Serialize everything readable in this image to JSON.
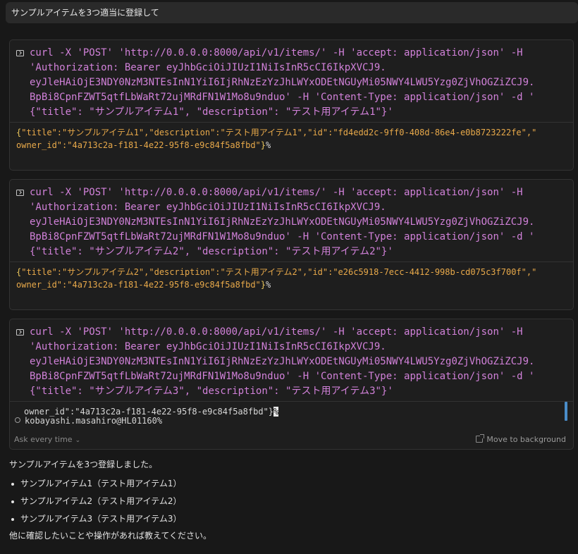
{
  "prompt": "サンプルアイテムを3つ適当に登録して",
  "blocks": [
    {
      "command": [
        "curl -X 'POST' 'http://0.0.0.0:8000/api/v1/items/' -H 'accept: application/json' -H",
        "'Authorization: Bearer eyJhbGciOiJIUzI1NiIsInR5cCI6IkpXVCJ9.",
        "eyJleHAiOjE3NDY0NzM3NTEsInN1YiI6IjRhNzEzYzJhLWYxODEtNGUyMi05NWY4LWU5Yzg0ZjVhOGZiZCJ9.",
        "BpBi8CpnFZWT5qtfLbWaRt72ujMRdFN1W1Mo8u9nduo' -H 'Content-Type: application/json' -d '",
        "{\"title\": \"サンプルアイテム1\", \"description\": \"テスト用アイテム1\"}'"
      ],
      "output_line1": "\"title\":\"サンプルアイテム1\",\"description\":\"テスト用アイテム1\",\"id\":\"fd4edd2c-9ff0-408d-86e4-e0b8723222fe\",\"",
      "output_line2": "owner_id\":\"4a713c2a-f181-4e22-95f8-e9c84f5a8fbd\""
    },
    {
      "command": [
        "curl -X 'POST' 'http://0.0.0.0:8000/api/v1/items/' -H 'accept: application/json' -H",
        "'Authorization: Bearer eyJhbGciOiJIUzI1NiIsInR5cCI6IkpXVCJ9.",
        "eyJleHAiOjE3NDY0NzM3NTEsInN1YiI6IjRhNzEzYzJhLWYxODEtNGUyMi05NWY4LWU5Yzg0ZjVhOGZiZCJ9.",
        "BpBi8CpnFZWT5qtfLbWaRt72ujMRdFN1W1Mo8u9nduo' -H 'Content-Type: application/json' -d '",
        "{\"title\": \"サンプルアイテム2\", \"description\": \"テスト用アイテム2\"}'"
      ],
      "output_line1": "\"title\":\"サンプルアイテム2\",\"description\":\"テスト用アイテム2\",\"id\":\"e26c5918-7ecc-4412-998b-cd075c3f700f\",\"",
      "output_line2": "owner_id\":\"4a713c2a-f181-4e22-95f8-e9c84f5a8fbd\""
    },
    {
      "command": [
        "curl -X 'POST' 'http://0.0.0.0:8000/api/v1/items/' -H 'accept: application/json' -H",
        "'Authorization: Bearer eyJhbGciOiJIUzI1NiIsInR5cCI6IkpXVCJ9.",
        "eyJleHAiOjE3NDY0NzM3NTEsInN1YiI6IjRhNzEzYzJhLWYxODEtNGUyMi05NWY4LWU5Yzg0ZjVhOGZiZCJ9.",
        "BpBi8CpnFZWT5qtfLbWaRt72ujMRdFN1W1Mo8u9nduo' -H 'Content-Type: application/json' -d '",
        "{\"title\": \"サンプルアイテム3\", \"description\": \"テスト用アイテム3\"}'"
      ],
      "output_line1": "owner_id\":\"4a713c2a-f181-4e22-95f8-e9c84f5a8fbd\"}",
      "shell_prompt": "kobayashi.masahiro@HL01160%",
      "ask_label": "Ask every time",
      "move_label": "Move to background"
    }
  ],
  "brace_open": "{",
  "brace_close": "}",
  "percent": "%",
  "answer": {
    "intro": "サンプルアイテムを3つ登録しました。",
    "items": [
      "サンプルアイテム1（テスト用アイテム1）",
      "サンプルアイテム2（テスト用アイテム2）",
      "サンプルアイテム3（テスト用アイテム3）"
    ],
    "outro": "他に確認したいことや操作があれば教えてください。"
  },
  "colors": {
    "command": "#d181d9",
    "output": "#e8a94a",
    "scroll_accent": "#4a8cc8"
  }
}
